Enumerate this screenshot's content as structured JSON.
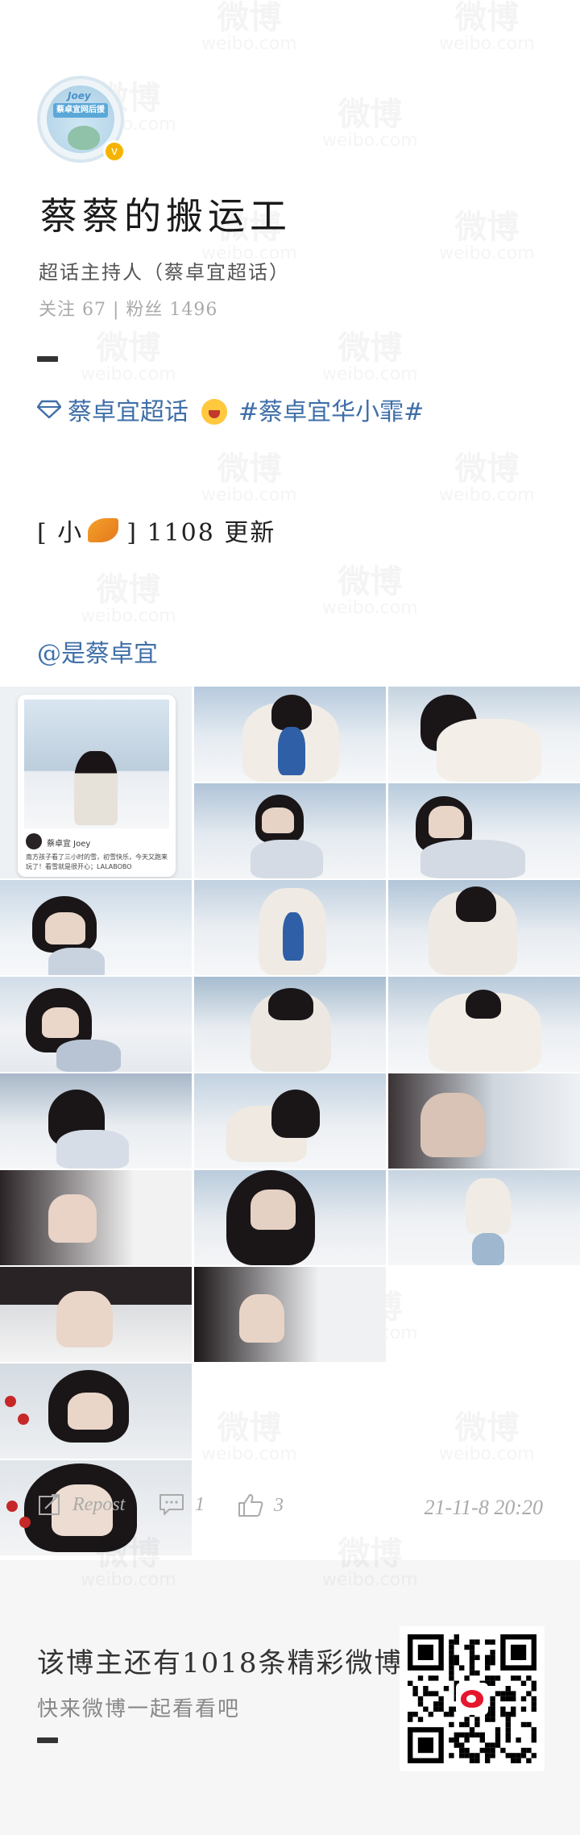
{
  "profile": {
    "avatar_tag": "Joey",
    "avatar_banner": "蔡卓宜网后援",
    "verify_badge": "v",
    "nickname": "蔡蔡的搬运工",
    "role": "超话主持人（蔡卓宜超话）",
    "stats": "关注 67 | 粉丝 1496"
  },
  "post": {
    "topic_label": "蔡卓宜超话",
    "hashtag": "#蔡卓宜华小霏#",
    "update_open": "[ 小",
    "update_close": "] 1108 更新",
    "mention": "@是蔡卓宜",
    "embedded_card": {
      "name": "蔡卓宜 Joey",
      "text": "南方孩子看了三小时的雪，初雪快乐，今天又跑来玩了！看雪就是很开心；LALABOBO"
    }
  },
  "actions": {
    "repost_label": "Repost",
    "comment_count": "1",
    "like_count": "3",
    "timestamp": "21-11-8 20:20"
  },
  "footer": {
    "more_text": "该博主还有1018条精彩微博",
    "sub_text": "快来微博一起看看吧"
  },
  "watermark": {
    "cn": "微博",
    "en": "weibo.com"
  },
  "colors": {
    "topic_blue": "#3f6fa8",
    "verify_gold": "#f5b400",
    "muted_gray": "#aaaaaa"
  }
}
